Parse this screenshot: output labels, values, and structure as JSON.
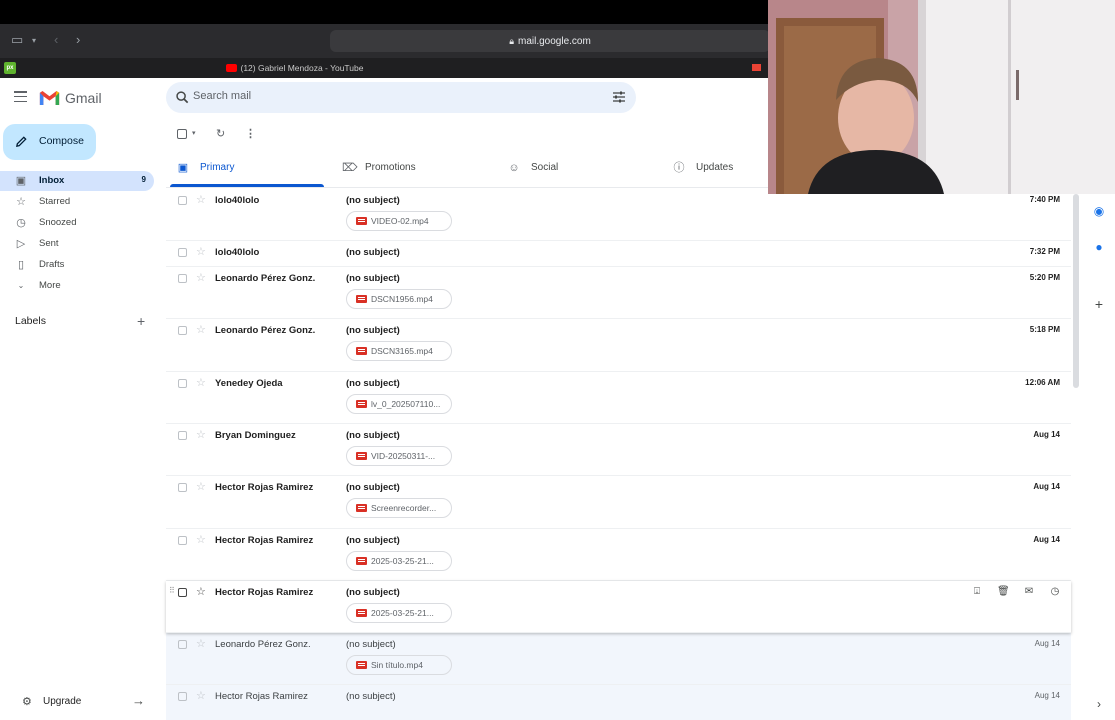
{
  "browser": {
    "url": "mail.google.com",
    "active_tab_title": "(12) Gabriel Mendoza - YouTube",
    "pinned_tab_badge": "px"
  },
  "app": {
    "name": "Gmail"
  },
  "search": {
    "placeholder": "Search mail"
  },
  "compose": {
    "label": "Compose"
  },
  "sidebar": {
    "items": [
      {
        "label": "Inbox",
        "count": "9",
        "icon": "inbox-icon"
      },
      {
        "label": "Starred",
        "icon": "star-icon"
      },
      {
        "label": "Snoozed",
        "icon": "clock-icon"
      },
      {
        "label": "Sent",
        "icon": "send-icon"
      },
      {
        "label": "Drafts",
        "icon": "draft-icon"
      },
      {
        "label": "More",
        "icon": "chevron-down-icon"
      }
    ],
    "labels_title": "Labels",
    "upgrade_label": "Upgrade"
  },
  "tabs": [
    {
      "label": "Primary",
      "icon": "inbox-icon",
      "active": true
    },
    {
      "label": "Promotions",
      "icon": "tag-icon"
    },
    {
      "label": "Social",
      "icon": "people-icon"
    },
    {
      "label": "Updates",
      "icon": "info-icon"
    }
  ],
  "emails": [
    {
      "sender": "lolo40lolo",
      "subject": "(no subject)",
      "attachment": "VIDEO-02.mp4",
      "date": "7:40 PM"
    },
    {
      "sender": "lolo40lolo",
      "subject": "(no subject)",
      "attachment": "",
      "date": "7:32 PM"
    },
    {
      "sender": "Leonardo Pérez Gonz.",
      "subject": "(no subject)",
      "attachment": "DSCN1956.mp4",
      "date": "5:20 PM"
    },
    {
      "sender": "Leonardo Pérez Gonz.",
      "subject": "(no subject)",
      "attachment": "DSCN3165.mp4",
      "date": "5:18 PM"
    },
    {
      "sender": "Yenedey Ojeda",
      "subject": "(no subject)",
      "attachment": "lv_0_202507110...",
      "date": "12:06 AM"
    },
    {
      "sender": "Bryan Dominguez",
      "subject": "(no subject)",
      "attachment": "VID-20250311-...",
      "date": "Aug 14"
    },
    {
      "sender": "Hector Rojas Ramirez",
      "subject": "(no subject)",
      "attachment": "Screenrecorder...",
      "date": "Aug 14"
    },
    {
      "sender": "Hector Rojas Ramirez",
      "subject": "(no subject)",
      "attachment": "2025-03-25-21...",
      "date": "Aug 14"
    },
    {
      "sender": "Hector Rojas Ramirez",
      "subject": "(no subject)",
      "attachment": "2025-03-25-21...",
      "date": "",
      "hovered": true
    },
    {
      "sender": "Leonardo Pérez Gonz.",
      "subject": "(no subject)",
      "attachment": "Sin título.mp4",
      "date": "Aug 14",
      "read": true
    },
    {
      "sender": "Hector Rojas Ramirez",
      "subject": "(no subject)",
      "attachment": "",
      "date": "Aug 14",
      "read": true
    }
  ],
  "colors": {
    "accent": "#0b57d0",
    "compose_bg": "#c2e7ff",
    "nav_active_bg": "#d3e3fd",
    "attachment_icon": "#d93025"
  }
}
